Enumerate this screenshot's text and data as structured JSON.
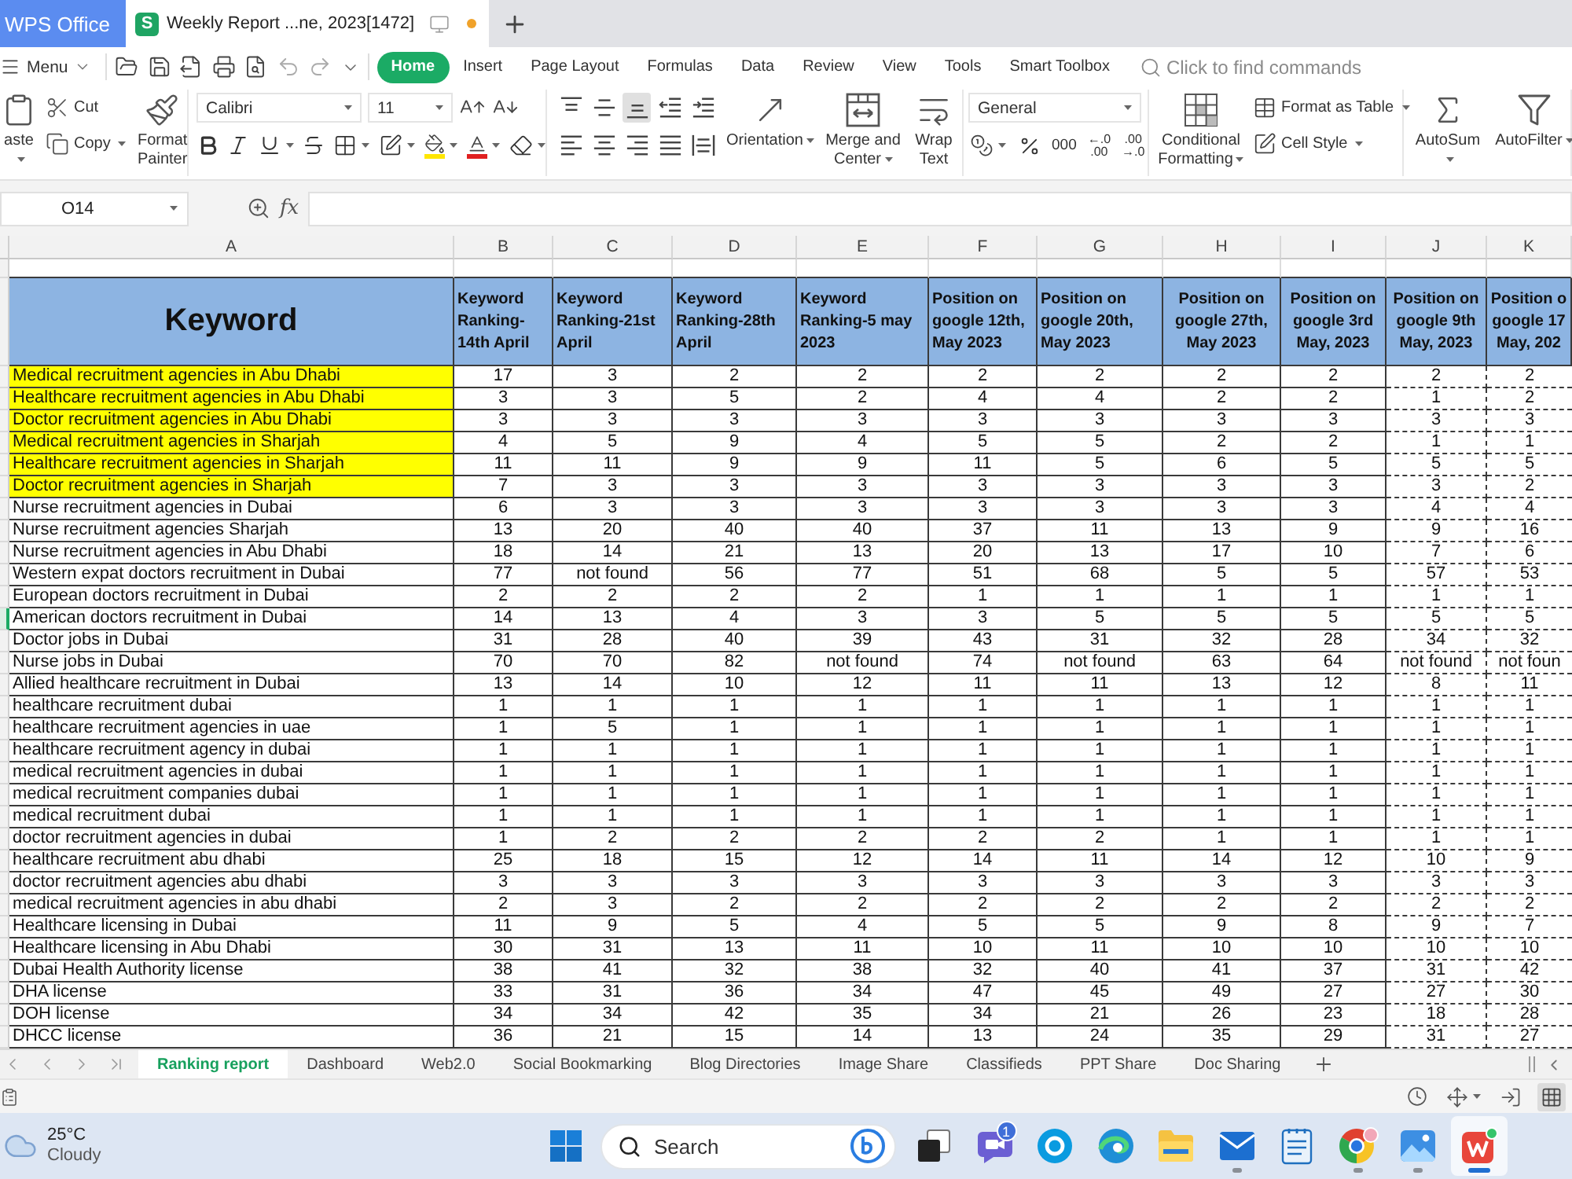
{
  "title_bar": {
    "app_tab": "WPS Office",
    "document_tab": {
      "badge": "S",
      "title": "Weekly Report ...ne, 2023[1472]",
      "unsaved": true
    }
  },
  "menu_bar": {
    "menu": "Menu",
    "tabs": [
      {
        "label": "Home",
        "selected": true
      },
      {
        "label": "Insert",
        "selected": false
      },
      {
        "label": "Page Layout",
        "selected": false
      },
      {
        "label": "Formulas",
        "selected": false
      },
      {
        "label": "Data",
        "selected": false
      },
      {
        "label": "Review",
        "selected": false
      },
      {
        "label": "View",
        "selected": false
      },
      {
        "label": "Tools",
        "selected": false
      },
      {
        "label": "Smart Toolbox",
        "selected": false
      }
    ],
    "command_search": {
      "placeholder": "Click to find commands"
    }
  },
  "ribbon": {
    "paste": "aste",
    "cut": "Cut",
    "copy": "Copy",
    "format_painter": "Format Painter",
    "font": {
      "name": "Calibri",
      "size": "11"
    },
    "vertical_align": [
      {
        "kind": "top",
        "selected": false
      },
      {
        "kind": "middle",
        "selected": false
      },
      {
        "kind": "bottom",
        "selected": true
      }
    ],
    "horizontal_align": [
      {
        "kind": "left",
        "selected": false
      },
      {
        "kind": "center",
        "selected": false
      },
      {
        "kind": "right",
        "selected": false
      },
      {
        "kind": "justify",
        "selected": false
      },
      {
        "kind": "distributed",
        "selected": false
      }
    ],
    "orientation": "Orientation",
    "merge_and_center": "Merge and Center",
    "wrap_text": "Wrap Text",
    "number_format": "General",
    "thousands_separator": "000",
    "increase_decimal": [
      "←.0",
      ".00"
    ],
    "decrease_decimal": [
      ".00",
      "→.0"
    ],
    "conditional_formatting": "Conditional Formatting",
    "format_as_table": "Format as Table",
    "cell_style": "Cell Style",
    "autosum": "AutoSum",
    "autofilter": "AutoFilter"
  },
  "formula_bar": {
    "name_box": "O14",
    "function_button": "fx"
  },
  "sheet": {
    "columns": [
      "A",
      "B",
      "C",
      "D",
      "E",
      "F",
      "G",
      "H",
      "I",
      "J",
      "K"
    ],
    "headers": [
      [
        "Keyword"
      ],
      [
        "Keyword",
        "Ranking-",
        "14th April"
      ],
      [
        "Keyword",
        "Ranking-21st",
        "April"
      ],
      [
        "Keyword",
        "Ranking-28th",
        "April"
      ],
      [
        "Keyword",
        "Ranking-5 may",
        "2023"
      ],
      [
        "Position on",
        "google 12th,",
        "May 2023"
      ],
      [
        "Position on",
        "google 20th,",
        "May 2023"
      ],
      [
        "Position on",
        "google 27th,",
        "May 2023"
      ],
      [
        "Position on",
        "google 3rd",
        "May, 2023"
      ],
      [
        "Position on",
        "google 9th",
        "May, 2023"
      ],
      [
        "Position o",
        "google 17",
        "May, 202"
      ]
    ],
    "rows": [
      {
        "keyword": "Medical recruitment agencies in Abu Dhabi",
        "highlighted": true,
        "selected": false,
        "values": [
          "17",
          "3",
          "2",
          "2",
          "2",
          "2",
          "2",
          "2",
          "2",
          "2"
        ]
      },
      {
        "keyword": "Healthcare recruitment agencies in Abu Dhabi",
        "highlighted": true,
        "selected": false,
        "values": [
          "3",
          "3",
          "5",
          "2",
          "4",
          "4",
          "2",
          "2",
          "1",
          "2"
        ]
      },
      {
        "keyword": "Doctor recruitment agencies in Abu Dhabi",
        "highlighted": true,
        "selected": false,
        "values": [
          "3",
          "3",
          "3",
          "3",
          "3",
          "3",
          "3",
          "3",
          "3",
          "3"
        ]
      },
      {
        "keyword": "Medical recruitment agencies in Sharjah",
        "highlighted": true,
        "selected": false,
        "values": [
          "4",
          "5",
          "9",
          "4",
          "5",
          "5",
          "2",
          "2",
          "1",
          "1"
        ]
      },
      {
        "keyword": "Healthcare recruitment agencies in Sharjah",
        "highlighted": true,
        "selected": false,
        "values": [
          "11",
          "11",
          "9",
          "9",
          "11",
          "5",
          "6",
          "5",
          "5",
          "5"
        ]
      },
      {
        "keyword": "Doctor recruitment agencies in Sharjah",
        "highlighted": true,
        "selected": false,
        "values": [
          "7",
          "3",
          "3",
          "3",
          "3",
          "3",
          "3",
          "3",
          "3",
          "2"
        ]
      },
      {
        "keyword": "Nurse recruitment agencies in Dubai",
        "highlighted": false,
        "selected": false,
        "values": [
          "6",
          "3",
          "3",
          "3",
          "3",
          "3",
          "3",
          "3",
          "4",
          "4"
        ]
      },
      {
        "keyword": "Nurse recruitment agencies Sharjah",
        "highlighted": false,
        "selected": false,
        "values": [
          "13",
          "20",
          "40",
          "40",
          "37",
          "11",
          "13",
          "9",
          "9",
          "16"
        ]
      },
      {
        "keyword": "Nurse recruitment agencies in Abu Dhabi",
        "highlighted": false,
        "selected": false,
        "values": [
          "18",
          "14",
          "21",
          "13",
          "20",
          "13",
          "17",
          "10",
          "7",
          "6"
        ]
      },
      {
        "keyword": "Western expat doctors recruitment in Dubai",
        "highlighted": false,
        "selected": false,
        "values": [
          "77",
          "not found",
          "56",
          "77",
          "51",
          "68",
          "5",
          "5",
          "57",
          "53"
        ]
      },
      {
        "keyword": "European doctors recruitment in Dubai",
        "highlighted": false,
        "selected": false,
        "values": [
          "2",
          "2",
          "2",
          "2",
          "1",
          "1",
          "1",
          "1",
          "1",
          "1"
        ]
      },
      {
        "keyword": "American doctors recruitment in Dubai",
        "highlighted": false,
        "selected": true,
        "values": [
          "14",
          "13",
          "4",
          "3",
          "3",
          "5",
          "5",
          "5",
          "5",
          "5"
        ]
      },
      {
        "keyword": "Doctor jobs in Dubai",
        "highlighted": false,
        "selected": false,
        "values": [
          "31",
          "28",
          "40",
          "39",
          "43",
          "31",
          "32",
          "28",
          "34",
          "32"
        ]
      },
      {
        "keyword": "Nurse jobs in Dubai",
        "highlighted": false,
        "selected": false,
        "values": [
          "70",
          "70",
          "82",
          "not found",
          "74",
          "not found",
          "63",
          "64",
          "not found",
          "not foun"
        ]
      },
      {
        "keyword": "Allied healthcare recruitment in Dubai",
        "highlighted": false,
        "selected": false,
        "values": [
          "13",
          "14",
          "10",
          "12",
          "11",
          "11",
          "13",
          "12",
          "8",
          "11"
        ]
      },
      {
        "keyword": "healthcare recruitment dubai",
        "highlighted": false,
        "selected": false,
        "values": [
          "1",
          "1",
          "1",
          "1",
          "1",
          "1",
          "1",
          "1",
          "1",
          "1"
        ]
      },
      {
        "keyword": "healthcare recruitment agencies in uae",
        "highlighted": false,
        "selected": false,
        "values": [
          "1",
          "5",
          "1",
          "1",
          "1",
          "1",
          "1",
          "1",
          "1",
          "1"
        ]
      },
      {
        "keyword": "healthcare recruitment agency in dubai",
        "highlighted": false,
        "selected": false,
        "values": [
          "1",
          "1",
          "1",
          "1",
          "1",
          "1",
          "1",
          "1",
          "1",
          "1"
        ]
      },
      {
        "keyword": "medical recruitment agencies in dubai",
        "highlighted": false,
        "selected": false,
        "values": [
          "1",
          "1",
          "1",
          "1",
          "1",
          "1",
          "1",
          "1",
          "1",
          "1"
        ]
      },
      {
        "keyword": "medical recruitment companies dubai",
        "highlighted": false,
        "selected": false,
        "values": [
          "1",
          "1",
          "1",
          "1",
          "1",
          "1",
          "1",
          "1",
          "1",
          "1"
        ]
      },
      {
        "keyword": "medical recruitment dubai",
        "highlighted": false,
        "selected": false,
        "values": [
          "1",
          "1",
          "1",
          "1",
          "1",
          "1",
          "1",
          "1",
          "1",
          "1"
        ]
      },
      {
        "keyword": "doctor recruitment agencies in dubai",
        "highlighted": false,
        "selected": false,
        "values": [
          "1",
          "2",
          "2",
          "2",
          "2",
          "2",
          "1",
          "1",
          "1",
          "1"
        ]
      },
      {
        "keyword": "healthcare recruitment abu dhabi",
        "highlighted": false,
        "selected": false,
        "values": [
          "25",
          "18",
          "15",
          "12",
          "14",
          "11",
          "14",
          "12",
          "10",
          "9"
        ]
      },
      {
        "keyword": "doctor recruitment agencies abu dhabi",
        "highlighted": false,
        "selected": false,
        "values": [
          "3",
          "3",
          "3",
          "3",
          "3",
          "3",
          "3",
          "3",
          "3",
          "3"
        ]
      },
      {
        "keyword": "medical recruitment agencies in abu dhabi",
        "highlighted": false,
        "selected": false,
        "values": [
          "2",
          "3",
          "2",
          "2",
          "2",
          "2",
          "2",
          "2",
          "2",
          "2"
        ]
      },
      {
        "keyword": "Healthcare licensing in Dubai",
        "highlighted": false,
        "selected": false,
        "values": [
          "11",
          "9",
          "5",
          "4",
          "5",
          "5",
          "9",
          "8",
          "9",
          "7"
        ]
      },
      {
        "keyword": "Healthcare licensing in Abu Dhabi",
        "highlighted": false,
        "selected": false,
        "values": [
          "30",
          "31",
          "13",
          "11",
          "10",
          "11",
          "10",
          "10",
          "10",
          "10"
        ]
      },
      {
        "keyword": "Dubai Health Authority license",
        "highlighted": false,
        "selected": false,
        "values": [
          "38",
          "41",
          "32",
          "38",
          "32",
          "40",
          "41",
          "37",
          "31",
          "42"
        ]
      },
      {
        "keyword": "DHA license",
        "highlighted": false,
        "selected": false,
        "values": [
          "33",
          "31",
          "36",
          "34",
          "47",
          "45",
          "49",
          "27",
          "27",
          "30"
        ]
      },
      {
        "keyword": "DOH license",
        "highlighted": false,
        "selected": false,
        "values": [
          "34",
          "34",
          "42",
          "35",
          "34",
          "21",
          "26",
          "23",
          "18",
          "28"
        ]
      },
      {
        "keyword": "DHCC license",
        "highlighted": false,
        "selected": false,
        "values": [
          "36",
          "21",
          "15",
          "14",
          "13",
          "24",
          "35",
          "29",
          "31",
          "27"
        ]
      }
    ]
  },
  "sheet_tabs": [
    {
      "label": "Ranking report",
      "selected": true
    },
    {
      "label": "Dashboard",
      "selected": false
    },
    {
      "label": "Web2.0",
      "selected": false
    },
    {
      "label": "Social Bookmarking",
      "selected": false
    },
    {
      "label": "Blog Directories",
      "selected": false
    },
    {
      "label": "Image Share",
      "selected": false
    },
    {
      "label": "Classifieds",
      "selected": false
    },
    {
      "label": "PPT Share",
      "selected": false
    },
    {
      "label": "Doc Sharing",
      "selected": false
    }
  ],
  "status_bar": {
    "view_modes": [
      {
        "kind": "reading",
        "selected": false
      },
      {
        "kind": "focus",
        "selected": false
      },
      {
        "kind": "page",
        "selected": false
      },
      {
        "kind": "normal",
        "selected": true
      }
    ]
  },
  "taskbar": {
    "weather": {
      "temperature": "25°C",
      "condition": "Cloudy"
    },
    "search": {
      "placeholder": "Search"
    },
    "apps": [
      {
        "kind": "task-view",
        "running": false,
        "active": false
      },
      {
        "kind": "chat",
        "badge": "1",
        "running": false,
        "active": false
      },
      {
        "kind": "call",
        "running": false,
        "active": false
      },
      {
        "kind": "browser",
        "running": false,
        "active": false
      },
      {
        "kind": "folder",
        "running": false,
        "active": false
      },
      {
        "kind": "mail",
        "running": true,
        "active": false
      },
      {
        "kind": "notepad",
        "running": false,
        "active": false
      },
      {
        "kind": "web",
        "running": true,
        "active": false
      },
      {
        "kind": "photos",
        "running": true,
        "active": false
      },
      {
        "kind": "office",
        "running": true,
        "active": true
      }
    ]
  }
}
